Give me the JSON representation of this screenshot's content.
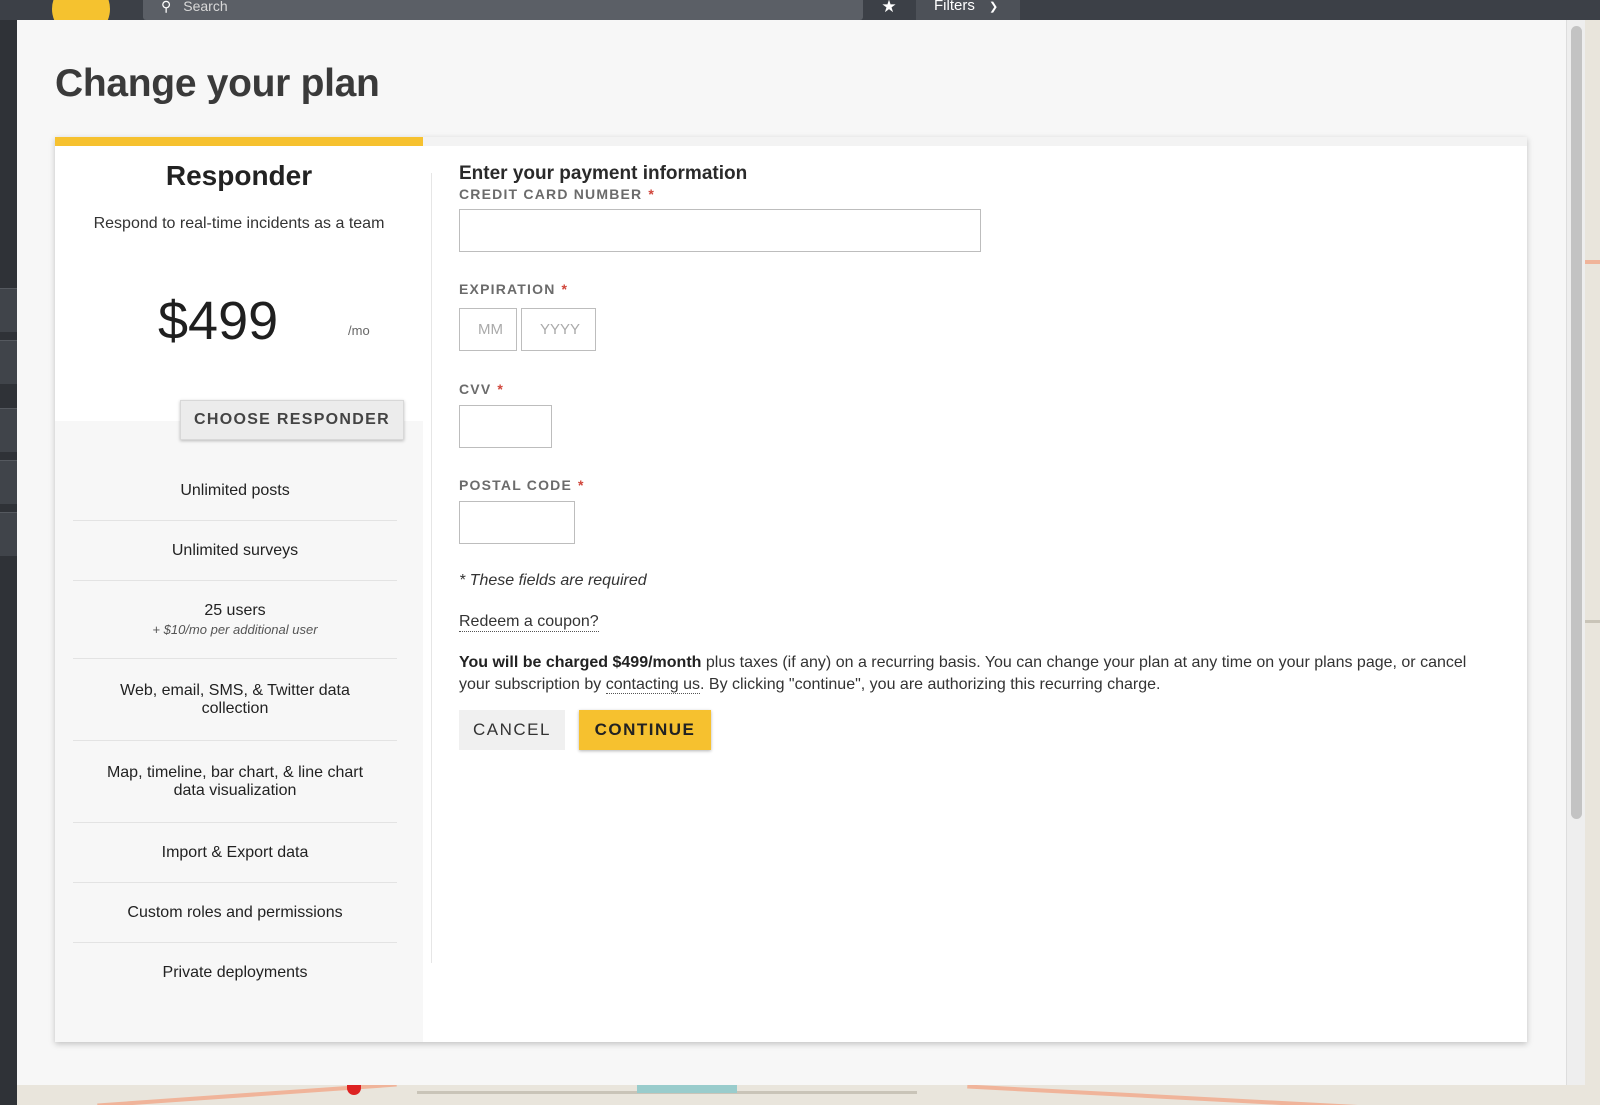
{
  "topbar": {
    "search_label": "Search",
    "filters_label": "Filters"
  },
  "page_title": "Change your plan",
  "plan": {
    "name": "Responder",
    "description": "Respond to real-time incidents as a team",
    "price": "$499",
    "price_unit": "/mo",
    "choose_label": "CHOOSE RESPONDER",
    "features": [
      {
        "text": "Unlimited posts",
        "sub": ""
      },
      {
        "text": "Unlimited surveys",
        "sub": ""
      },
      {
        "text": "25 users",
        "sub": "+ $10/mo per additional user"
      },
      {
        "text": "Web, email, SMS, & Twitter data collection",
        "sub": ""
      },
      {
        "text": "Map, timeline, bar chart, & line chart data visualization",
        "sub": ""
      },
      {
        "text": "Import & Export data",
        "sub": ""
      },
      {
        "text": "Custom roles and permissions",
        "sub": ""
      },
      {
        "text": "Private deployments",
        "sub": ""
      }
    ]
  },
  "payment": {
    "title": "Enter your payment information",
    "card_label": "CREDIT CARD NUMBER",
    "card_value": "",
    "expiration_label": "EXPIRATION",
    "exp_month_placeholder": "MM",
    "exp_year_placeholder": "YYYY",
    "cvv_label": "CVV",
    "cvv_value": "",
    "postal_label": "POSTAL CODE",
    "postal_value": "",
    "required_mark": "*",
    "required_note": "* These fields are required",
    "coupon_link": "Redeem a coupon?",
    "charge_bold": "You will be charged $499/month",
    "charge_text_1": " plus taxes (if any) on a recurring basis. You can change your plan at any time on your plans page, or cancel your subscription by ",
    "charge_link": "contacting us",
    "charge_text_2": ". By clicking \"continue\", you are authorizing this recurring charge.",
    "cancel_label": "CANCEL",
    "continue_label": "CONTINUE"
  },
  "colors": {
    "accent": "#f6c12f",
    "required": "#d0453a"
  }
}
